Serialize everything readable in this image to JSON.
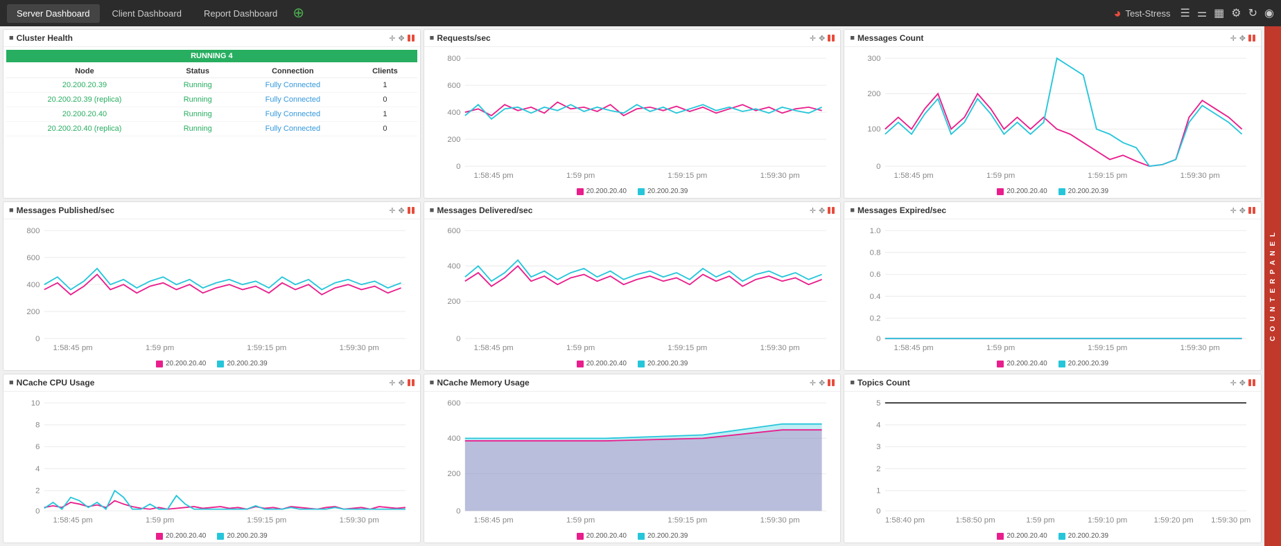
{
  "nav": {
    "tabs": [
      "Server Dashboard",
      "Client Dashboard",
      "Report Dashboard"
    ],
    "active_tab": "Server Dashboard",
    "brand": "Test-Stress"
  },
  "counter_panel": {
    "label": "C O U N T E R   P A N E L"
  },
  "widgets": {
    "cluster_health": {
      "title": "Cluster Health",
      "running_label": "RUNNING 4",
      "columns": [
        "Node",
        "Status",
        "Connection",
        "Clients"
      ],
      "rows": [
        {
          "node": "20.200.20.39",
          "status": "Running",
          "connection": "Fully Connected",
          "clients": "1"
        },
        {
          "node": "20.200.20.39 (replica)",
          "status": "Running",
          "connection": "Fully Connected",
          "clients": "0"
        },
        {
          "node": "20.200.20.40",
          "status": "Running",
          "connection": "Fully Connected",
          "clients": "1"
        },
        {
          "node": "20.200.20.40 (replica)",
          "status": "Running",
          "connection": "Fully Connected",
          "clients": "0"
        }
      ]
    },
    "requests_sec": {
      "title": "Requests/sec",
      "legend": [
        "20.200.20.40",
        "20.200.20.39"
      ],
      "x_labels": [
        "1:58:45 pm",
        "1:59 pm",
        "1:59:15 pm",
        "1:59:30 pm"
      ],
      "y_labels": [
        "0",
        "200",
        "400",
        "600",
        "800"
      ]
    },
    "messages_count": {
      "title": "Messages Count",
      "legend": [
        "20.200.20.40",
        "20.200.20.39"
      ],
      "x_labels": [
        "1:58:45 pm",
        "1:59 pm",
        "1:59:15 pm",
        "1:59:30 pm"
      ],
      "y_labels": [
        "0",
        "100",
        "200",
        "300"
      ]
    },
    "messages_published": {
      "title": "Messages Published/sec",
      "legend": [
        "20.200.20.40",
        "20.200.20.39"
      ],
      "x_labels": [
        "1:58:45 pm",
        "1:59 pm",
        "1:59:15 pm",
        "1:59:30 pm"
      ],
      "y_labels": [
        "0",
        "200",
        "400",
        "600",
        "800"
      ]
    },
    "messages_delivered": {
      "title": "Messages Delivered/sec",
      "legend": [
        "20.200.20.40",
        "20.200.20.39"
      ],
      "x_labels": [
        "1:58:45 pm",
        "1:59 pm",
        "1:59:15 pm",
        "1:59:30 pm"
      ],
      "y_labels": [
        "0",
        "200",
        "400",
        "600"
      ]
    },
    "messages_expired": {
      "title": "Messages Expired/sec",
      "legend": [
        "20.200.20.40",
        "20.200.20.39"
      ],
      "x_labels": [
        "1:58:45 pm",
        "1:59 pm",
        "1:59:15 pm",
        "1:59:30 pm"
      ],
      "y_labels": [
        "0",
        "0.2",
        "0.4",
        "0.6",
        "0.8",
        "1.0"
      ]
    },
    "ncache_cpu": {
      "title": "NCache CPU Usage",
      "legend": [
        "20.200.20.40",
        "20.200.20.39"
      ],
      "x_labels": [
        "1:58:45 pm",
        "1:59 pm",
        "1:59:15 pm",
        "1:59:30 pm"
      ],
      "y_labels": [
        "0",
        "2",
        "4",
        "6",
        "8",
        "10"
      ]
    },
    "ncache_memory": {
      "title": "NCache Memory Usage",
      "legend": [
        "20.200.20.40",
        "20.200.20.39"
      ],
      "x_labels": [
        "1:58:45 pm",
        "1:59 pm",
        "1:59:15 pm",
        "1:59:30 pm"
      ],
      "y_labels": [
        "0",
        "200",
        "400",
        "600"
      ]
    },
    "topics_count": {
      "title": "Topics Count",
      "legend": [
        "20.200.20.40",
        "20.200.20.39"
      ],
      "x_labels": [
        "1:58:40 pm",
        "1:58:50 pm",
        "1:59 pm",
        "1:59:10 pm",
        "1:59:20 pm",
        "1:59:30 pm"
      ],
      "y_labels": [
        "0",
        "1",
        "2",
        "3",
        "4",
        "5"
      ]
    }
  }
}
